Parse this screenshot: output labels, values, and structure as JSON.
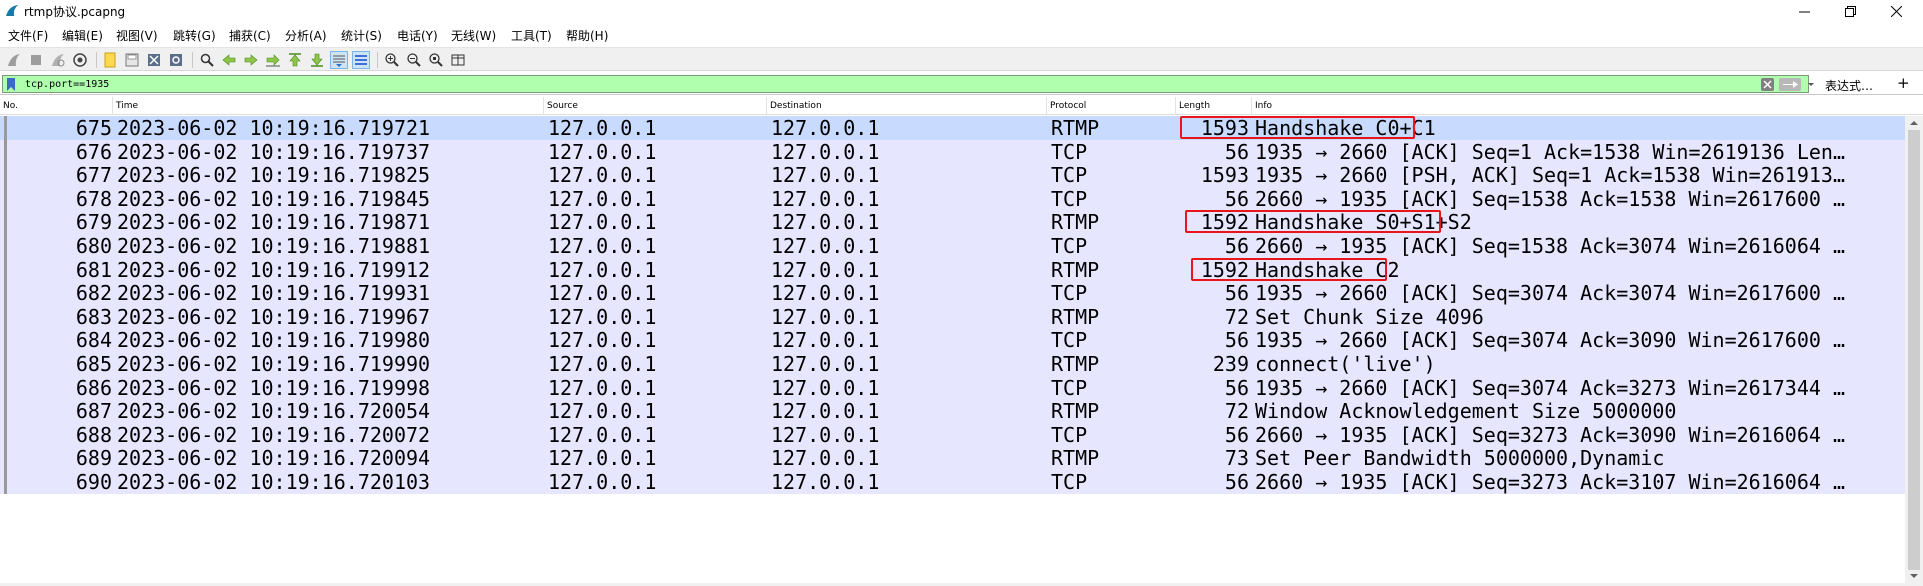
{
  "window": {
    "title": "rtmp协议.pcapng"
  },
  "menu": {
    "items": [
      {
        "label": "文件(F)"
      },
      {
        "label": "编辑(E)"
      },
      {
        "label": "视图(V)"
      },
      {
        "label": "跳转(G)"
      },
      {
        "label": "捕获(C)"
      },
      {
        "label": "分析(A)"
      },
      {
        "label": "统计(S)"
      },
      {
        "label": "电话(Y)"
      },
      {
        "label": "无线(W)"
      },
      {
        "label": "工具(T)"
      },
      {
        "label": "帮助(H)"
      }
    ]
  },
  "toolbar": {
    "icons": [
      "start-capture-icon",
      "stop-capture-icon",
      "restart-capture-icon",
      "capture-options-icon",
      "open-file-icon",
      "save-file-icon",
      "close-file-icon",
      "reload-file-icon",
      "find-packet-icon",
      "go-back-icon",
      "go-forward-icon",
      "go-to-packet-icon",
      "go-first-icon",
      "go-last-icon",
      "autoscroll-icon",
      "colorize-icon",
      "zoom-in-icon",
      "zoom-out-icon",
      "zoom-normal-icon",
      "resize-columns-icon"
    ]
  },
  "filter": {
    "value": "tcp.port==1935",
    "expression_label": "表达式…",
    "add_label": "+"
  },
  "columns": {
    "no": "No.",
    "time": "Time",
    "source": "Source",
    "destination": "Destination",
    "protocol": "Protocol",
    "length": "Length",
    "info": "Info"
  },
  "packets": [
    {
      "no": "675",
      "time": "2023-06-02 10:19:16.719721",
      "src": "127.0.0.1",
      "dst": "127.0.0.1",
      "proto": "RTMP",
      "len": "1593",
      "info": "Handshake C0+C1"
    },
    {
      "no": "676",
      "time": "2023-06-02 10:19:16.719737",
      "src": "127.0.0.1",
      "dst": "127.0.0.1",
      "proto": "TCP",
      "len": "56",
      "info": "1935 → 2660 [ACK] Seq=1 Ack=1538 Win=2619136 Len…"
    },
    {
      "no": "677",
      "time": "2023-06-02 10:19:16.719825",
      "src": "127.0.0.1",
      "dst": "127.0.0.1",
      "proto": "TCP",
      "len": "1593",
      "info": "1935 → 2660 [PSH, ACK] Seq=1 Ack=1538 Win=261913…"
    },
    {
      "no": "678",
      "time": "2023-06-02 10:19:16.719845",
      "src": "127.0.0.1",
      "dst": "127.0.0.1",
      "proto": "TCP",
      "len": "56",
      "info": "2660 → 1935 [ACK] Seq=1538 Ack=1538 Win=2617600 …"
    },
    {
      "no": "679",
      "time": "2023-06-02 10:19:16.719871",
      "src": "127.0.0.1",
      "dst": "127.0.0.1",
      "proto": "RTMP",
      "len": "1592",
      "info": "Handshake S0+S1+S2"
    },
    {
      "no": "680",
      "time": "2023-06-02 10:19:16.719881",
      "src": "127.0.0.1",
      "dst": "127.0.0.1",
      "proto": "TCP",
      "len": "56",
      "info": "2660 → 1935 [ACK] Seq=1538 Ack=3074 Win=2616064 …"
    },
    {
      "no": "681",
      "time": "2023-06-02 10:19:16.719912",
      "src": "127.0.0.1",
      "dst": "127.0.0.1",
      "proto": "RTMP",
      "len": "1592",
      "info": "Handshake C2"
    },
    {
      "no": "682",
      "time": "2023-06-02 10:19:16.719931",
      "src": "127.0.0.1",
      "dst": "127.0.0.1",
      "proto": "TCP",
      "len": "56",
      "info": "1935 → 2660 [ACK] Seq=3074 Ack=3074 Win=2617600 …"
    },
    {
      "no": "683",
      "time": "2023-06-02 10:19:16.719967",
      "src": "127.0.0.1",
      "dst": "127.0.0.1",
      "proto": "RTMP",
      "len": "72",
      "info": "Set Chunk Size 4096"
    },
    {
      "no": "684",
      "time": "2023-06-02 10:19:16.719980",
      "src": "127.0.0.1",
      "dst": "127.0.0.1",
      "proto": "TCP",
      "len": "56",
      "info": "1935 → 2660 [ACK] Seq=3074 Ack=3090 Win=2617600 …"
    },
    {
      "no": "685",
      "time": "2023-06-02 10:19:16.719990",
      "src": "127.0.0.1",
      "dst": "127.0.0.1",
      "proto": "RTMP",
      "len": "239",
      "info": "connect('live')"
    },
    {
      "no": "686",
      "time": "2023-06-02 10:19:16.719998",
      "src": "127.0.0.1",
      "dst": "127.0.0.1",
      "proto": "TCP",
      "len": "56",
      "info": "1935 → 2660 [ACK] Seq=3074 Ack=3273 Win=2617344 …"
    },
    {
      "no": "687",
      "time": "2023-06-02 10:19:16.720054",
      "src": "127.0.0.1",
      "dst": "127.0.0.1",
      "proto": "RTMP",
      "len": "72",
      "info": "Window Acknowledgement Size 5000000"
    },
    {
      "no": "688",
      "time": "2023-06-02 10:19:16.720072",
      "src": "127.0.0.1",
      "dst": "127.0.0.1",
      "proto": "TCP",
      "len": "56",
      "info": "2660 → 1935 [ACK] Seq=3273 Ack=3090 Win=2616064 …"
    },
    {
      "no": "689",
      "time": "2023-06-02 10:19:16.720094",
      "src": "127.0.0.1",
      "dst": "127.0.0.1",
      "proto": "RTMP",
      "len": "73",
      "info": "Set Peer Bandwidth 5000000,Dynamic"
    },
    {
      "no": "690",
      "time": "2023-06-02 10:19:16.720103",
      "src": "127.0.0.1",
      "dst": "127.0.0.1",
      "proto": "TCP",
      "len": "56",
      "info": "2660 → 1935 [ACK] Seq=3273 Ack=3107 Win=2616064 …"
    }
  ],
  "selected_row": "675",
  "highlighted_rows": [
    "675",
    "679",
    "681"
  ],
  "colors": {
    "row_bg": "#e7e6ff",
    "selected_bg": "#c8dbff",
    "filter_bg": "#afffaf",
    "highlight_box": "#e8151b"
  }
}
